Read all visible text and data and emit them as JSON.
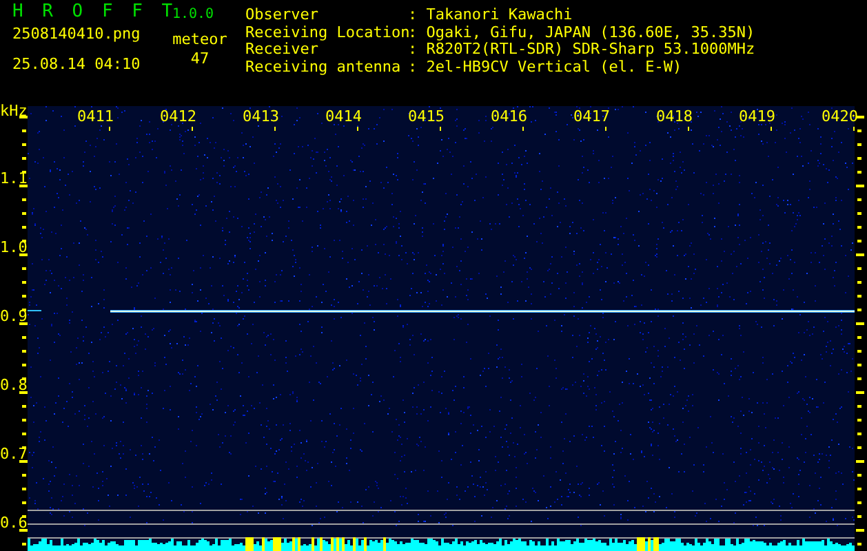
{
  "app": {
    "title": "H R O F F T",
    "version": "1.0.0"
  },
  "file": "2508140410.png",
  "datetime": "25.08.14 04:10",
  "meteor": {
    "label": "meteor",
    "count": "47"
  },
  "station": [
    {
      "label": "Observer",
      "value": ": Takanori Kawachi"
    },
    {
      "label": "Receiving Location",
      "value": ": Ogaki, Gifu, JAPAN (136.60E, 35.35N)"
    },
    {
      "label": "Receiver",
      "value": ": R820T2(RTL-SDR) SDR-Sharp 53.1000MHz"
    },
    {
      "label": "Receiving antenna",
      "value": ": 2el-HB9CV Vertical (el. E-W)"
    }
  ],
  "spectrogram": {
    "unit": "kHz",
    "time_labels": [
      "0411",
      "0412",
      "0413",
      "0414",
      "0415",
      "0416",
      "0417",
      "0418",
      "0419",
      "0420"
    ],
    "freq_labels": [
      "1.1",
      "1.0",
      "0.9",
      "0.8",
      "0.7",
      "0.6"
    ]
  }
}
